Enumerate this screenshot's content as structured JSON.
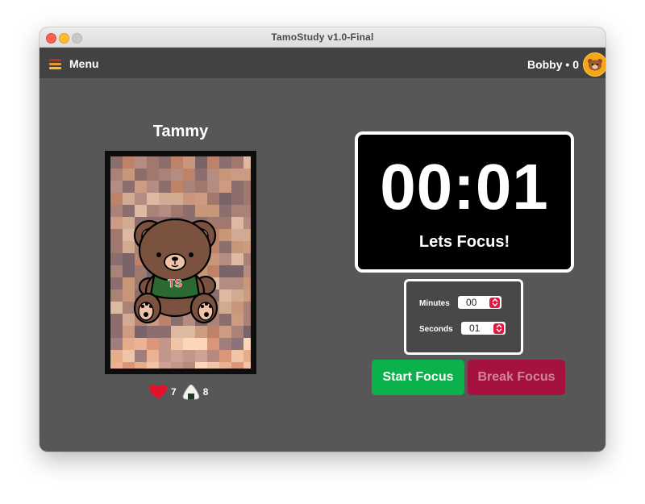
{
  "window": {
    "title": "TamoStudy v1.0-Final"
  },
  "topbar": {
    "menu_label": "Menu",
    "user_label": "Bobby • 0",
    "avatar_icon": "bear-avatar-icon"
  },
  "pet": {
    "name": "Tammy",
    "shirt_letters": "TS",
    "hearts": "7",
    "food": "8"
  },
  "timer": {
    "display": "00:01",
    "message": "Lets Focus!"
  },
  "settings": {
    "minutes_label": "Minutes",
    "minutes_value": "00",
    "seconds_label": "Seconds",
    "seconds_value": "01"
  },
  "buttons": {
    "start": "Start Focus",
    "break": "Break Focus"
  },
  "colors": {
    "background": "#575757",
    "topbar": "#424242",
    "start_button": "#0bb14b",
    "break_button": "#a5123f",
    "stepper_accent": "#e3163d",
    "avatar": "#f7a51a"
  }
}
